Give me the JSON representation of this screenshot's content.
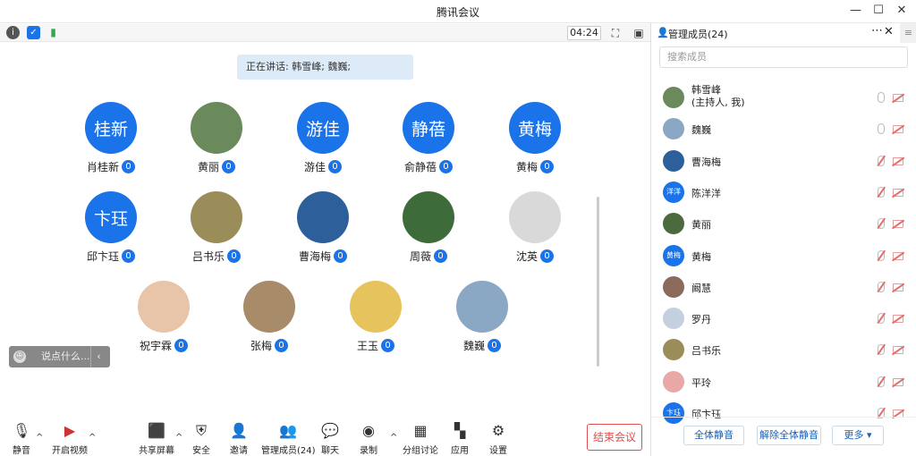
{
  "window": {
    "title": "腾讯会议"
  },
  "topbar": {
    "timer": "04:24"
  },
  "speaking": "正在讲话: 韩雪峰; 魏巍;",
  "tiles": [
    {
      "name": "肖桂新",
      "avatar_text": "桂新",
      "avatar_color": "#1a73e8"
    },
    {
      "name": "黄丽",
      "avatar_text": "",
      "avatar_color": "#6a8a5c"
    },
    {
      "name": "游佳",
      "avatar_text": "游佳",
      "avatar_color": "#1a73e8"
    },
    {
      "name": "俞静蓓",
      "avatar_text": "静蓓",
      "avatar_color": "#1a73e8"
    },
    {
      "name": "黄梅",
      "avatar_text": "黄梅",
      "avatar_color": "#1a73e8"
    },
    {
      "name": "邱卞珏",
      "avatar_text": "卞珏",
      "avatar_color": "#1a73e8"
    },
    {
      "name": "吕书乐",
      "avatar_text": "",
      "avatar_color": "#9a8d5a"
    },
    {
      "name": "曹海梅",
      "avatar_text": "",
      "avatar_color": "#2d5f9a"
    },
    {
      "name": "周薇",
      "avatar_text": "",
      "avatar_color": "#3d6b3a"
    },
    {
      "name": "沈英",
      "avatar_text": "",
      "avatar_color": "#d9d9d9"
    },
    {
      "name": "祝宇霖",
      "avatar_text": "",
      "avatar_color": "#e8c4a8"
    },
    {
      "name": "张梅",
      "avatar_text": "",
      "avatar_color": "#a88c6a"
    },
    {
      "name": "王玉",
      "avatar_text": "",
      "avatar_color": "#e6c35c"
    },
    {
      "name": "魏巍",
      "avatar_text": "",
      "avatar_color": "#8aa8c4"
    }
  ],
  "chat": {
    "placeholder": "说点什么..."
  },
  "toolbar": {
    "mute": "静音",
    "video": "开启视频",
    "share": "共享屏幕",
    "security": "安全",
    "invite": "邀请",
    "members": "管理成员(24)",
    "chat": "聊天",
    "record": "录制",
    "breakout": "分组讨论",
    "apps": "应用",
    "settings": "设置",
    "end": "结束会议"
  },
  "panel": {
    "title": "管理成员(24)",
    "search_placeholder": "搜索成员",
    "members": [
      {
        "name": "韩雪峰",
        "sub": "(主持人, 我)",
        "avatar_text": "",
        "avatar_color": "#6a8a5c",
        "mic": "on"
      },
      {
        "name": "魏巍",
        "sub": "",
        "avatar_text": "",
        "avatar_color": "#8aa8c4",
        "mic": "on"
      },
      {
        "name": "曹海梅",
        "sub": "",
        "avatar_text": "",
        "avatar_color": "#2d5f9a",
        "mic": "off"
      },
      {
        "name": "陈洋洋",
        "sub": "",
        "avatar_text": "洋洋",
        "avatar_color": "#1a73e8",
        "mic": "off"
      },
      {
        "name": "黄丽",
        "sub": "",
        "avatar_text": "",
        "avatar_color": "#4b6b3f",
        "mic": "off"
      },
      {
        "name": "黄梅",
        "sub": "",
        "avatar_text": "黄梅",
        "avatar_color": "#1a73e8",
        "mic": "off"
      },
      {
        "name": "阚慧",
        "sub": "",
        "avatar_text": "",
        "avatar_color": "#8a6a5a",
        "mic": "off"
      },
      {
        "name": "罗丹",
        "sub": "",
        "avatar_text": "",
        "avatar_color": "#c4cfe0",
        "mic": "off"
      },
      {
        "name": "吕书乐",
        "sub": "",
        "avatar_text": "",
        "avatar_color": "#9a8d5a",
        "mic": "off"
      },
      {
        "name": "平玲",
        "sub": "",
        "avatar_text": "",
        "avatar_color": "#e8a8a8",
        "mic": "off"
      },
      {
        "name": "邱卞珏",
        "sub": "",
        "avatar_text": "卞珏",
        "avatar_color": "#1a73e8",
        "mic": "off"
      }
    ],
    "mute_all": "全体静音",
    "unmute_all": "解除全体静音",
    "more": "更多 ▾"
  }
}
